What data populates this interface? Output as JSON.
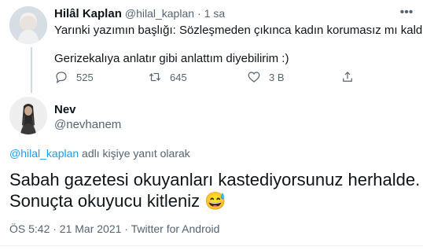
{
  "parent_tweet": {
    "display_name": "Hilâl Kaplan",
    "handle": "@hilal_kaplan",
    "sep": "·",
    "time": "1 sa",
    "text_line1": "Yarınki yazımın başlığı: Sözleşmeden çıkınca kadın korumasız mı kaldı?",
    "text_line2": "Gerizekalıya anlatır gibi anlattım diyebilirim :)",
    "actions": {
      "reply_count": "525",
      "retweet_count": "645",
      "like_count": "3 B"
    }
  },
  "reply_tweet": {
    "display_name": "Nev",
    "handle": "@nevhanem",
    "reply_to_handle": "@hilal_kaplan",
    "reply_to_suffix": " adlı kişiye yanıt olarak",
    "text_line1": "Sabah gazetesi okuyanları kastediyorsunuz herhalde.",
    "text_line2": "Sonuçta okuyucu kitleniz",
    "emoji": "😅",
    "meta": "ÖS 5:42 · 21 Mar 2021 · Twitter for Android"
  },
  "colors": {
    "accent": "#1d9bf0",
    "muted": "#536471",
    "text": "#0f1419"
  },
  "icons": [
    "reply-icon",
    "retweet-icon",
    "like-icon",
    "share-icon",
    "more-icon"
  ]
}
